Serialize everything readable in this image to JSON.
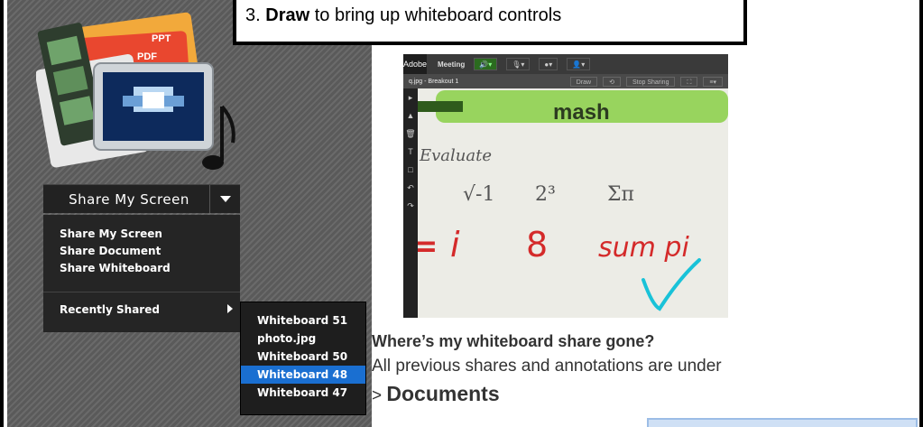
{
  "callout": {
    "step": "3. ",
    "bold": "Draw",
    "rest": " to bring up whiteboard controls"
  },
  "icon_art": {
    "ppt_label": "PPT",
    "pdf_label": "PDF"
  },
  "share_button": {
    "label": "Share My Screen"
  },
  "menu": {
    "items": [
      "Share My Screen",
      "Share Document",
      "Share Whiteboard"
    ],
    "recent_label": "Recently Shared"
  },
  "submenu": {
    "items": [
      "Whiteboard 51",
      "photo.jpg",
      "Whiteboard 50",
      "Whiteboard 48",
      "Whiteboard 47"
    ],
    "selected_index": 3
  },
  "screenshot": {
    "logo": "Adobe",
    "meeting_label": "Meeting",
    "pod_filename": "q.jpg",
    "pod_breakout": "- Breakout 1",
    "draw_button": "Draw",
    "stop_sharing_button": "Stop Sharing",
    "brand_text": "mash",
    "evaluate_text": "Evaluate",
    "expr1": "√-1",
    "expr2": "2³",
    "expr3": "Σπ",
    "answer_eq": "=",
    "answer_i": "i",
    "answer_8": "8",
    "answer_sum": "sum pi",
    "tools": [
      "▸",
      "▲",
      "🗑",
      "T",
      "□",
      "↶",
      "↷"
    ]
  },
  "question": {
    "title": "Where’s my whiteboard share gone?",
    "subtitle": "All previous shares and annotations are under",
    "doc_prefix": "> ",
    "doc_label": "Documents"
  },
  "colors": {
    "selection": "#1a6fd1",
    "marker_red": "#d42a2a",
    "checkmark": "#19c2d8",
    "pen_green": "#8fd14f"
  }
}
